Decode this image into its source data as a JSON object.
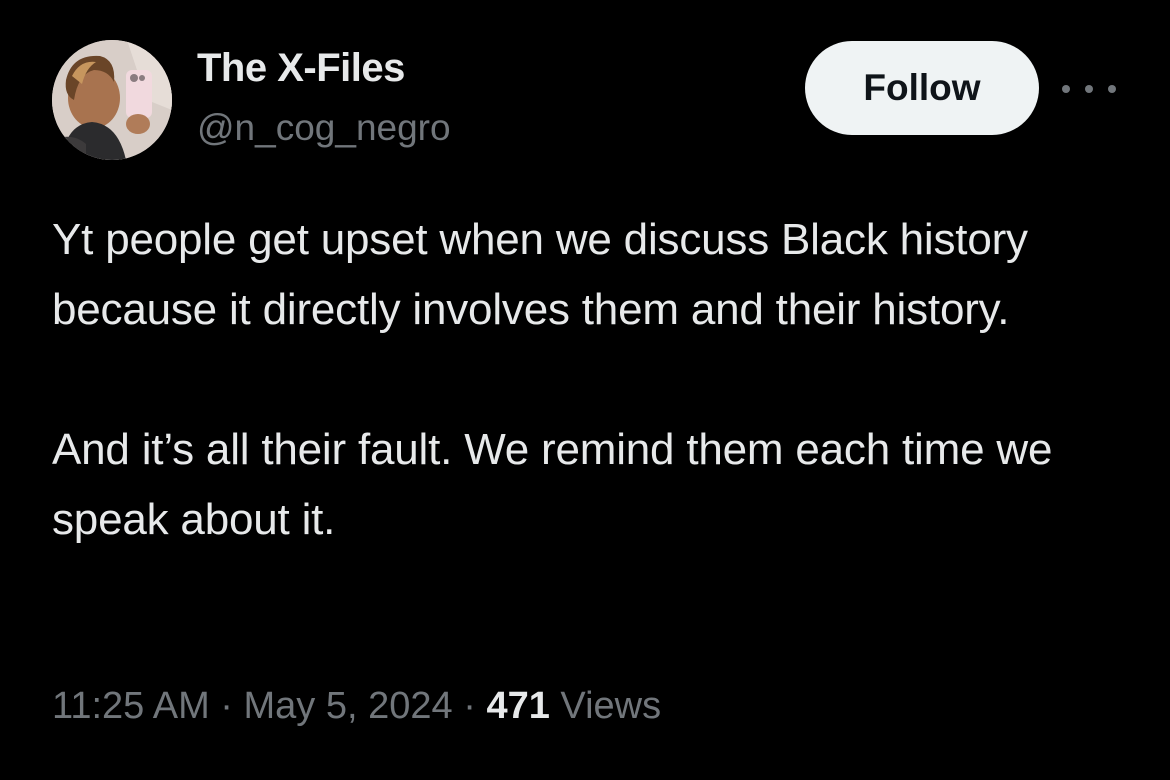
{
  "author": {
    "name": "The X-Files",
    "handle": "@n_cog_negro",
    "avatar_icon": "profile-photo"
  },
  "actions": {
    "follow_label": "Follow",
    "more_icon": "more-horizontal-icon"
  },
  "tweet": {
    "paragraphs": [
      "Yt people get upset when we discuss Black history because it directly involves them and their history.",
      "And it’s all their fault. We remind them each time we speak about it."
    ]
  },
  "meta": {
    "time": "11:25 AM",
    "separator": "·",
    "date": "May 5, 2024",
    "views_count": "471",
    "views_label": "Views"
  },
  "colors": {
    "background": "#000000",
    "primary_text": "#e7e9ea",
    "secondary_text": "#71767b",
    "follow_bg": "#eff3f4",
    "follow_text": "#0f1419"
  }
}
